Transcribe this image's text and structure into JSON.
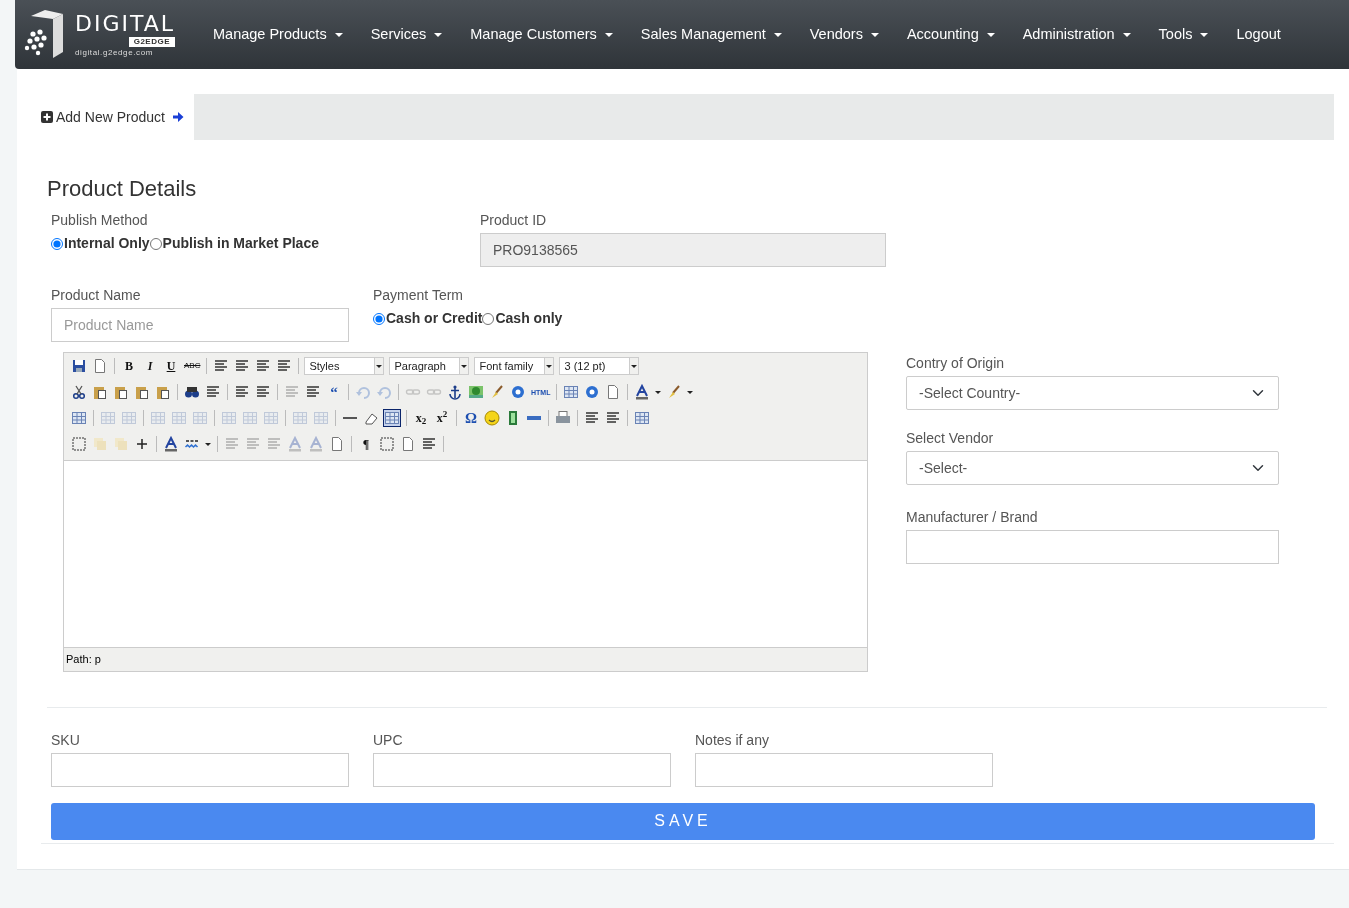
{
  "logo": {
    "word": "DIGITAL",
    "badge": "G2EDGE",
    "site": "digital.g2edge.com"
  },
  "menu": [
    {
      "label": "Manage Products",
      "dropdown": true
    },
    {
      "label": "Services",
      "dropdown": true
    },
    {
      "label": "Manage Customers",
      "dropdown": true
    },
    {
      "label": "Sales Management",
      "dropdown": true
    },
    {
      "label": "Vendors",
      "dropdown": true
    },
    {
      "label": "Accounting",
      "dropdown": true
    },
    {
      "label": "Administration",
      "dropdown": true
    },
    {
      "label": "Tools",
      "dropdown": true
    },
    {
      "label": "Logout",
      "dropdown": false
    }
  ],
  "breadcrumb": {
    "label": "Add New Product"
  },
  "heading": "Product Details",
  "publish_method": {
    "label": "Publish Method",
    "options": [
      {
        "label": "Internal Only",
        "selected": true
      },
      {
        "label": "Publish in Market Place",
        "selected": false
      }
    ]
  },
  "product_id": {
    "label": "Product ID",
    "value": "PRO9138565",
    "disabled": true
  },
  "product_name": {
    "label": "Product Name",
    "placeholder": "Product Name"
  },
  "payment_term": {
    "label": "Payment Term",
    "options": [
      {
        "label": "Cash or Credit",
        "selected": true
      },
      {
        "label": "Cash only",
        "selected": false
      }
    ]
  },
  "editor": {
    "toolbar": [
      [
        {
          "kind": "icon",
          "disabled": false,
          "active": false
        },
        {
          "kind": "icon",
          "disabled": false,
          "active": false
        },
        {
          "kind": "sep"
        },
        {
          "kind": "bold",
          "text": "B",
          "disabled": false,
          "active": false
        },
        {
          "kind": "italic",
          "text": "I",
          "disabled": false,
          "active": false
        },
        {
          "kind": "underline",
          "text": "U",
          "disabled": false,
          "active": false
        },
        {
          "kind": "strike",
          "text": "ABC",
          "disabled": false,
          "active": false
        },
        {
          "kind": "sep"
        },
        {
          "kind": "icon",
          "disabled": false,
          "active": false
        },
        {
          "kind": "icon",
          "disabled": false,
          "active": false
        },
        {
          "kind": "icon",
          "disabled": false,
          "active": false
        },
        {
          "kind": "icon",
          "disabled": false,
          "active": false
        },
        {
          "kind": "sep"
        },
        {
          "kind": "select",
          "text": "Styles"
        },
        {
          "kind": "select",
          "text": "Paragraph"
        },
        {
          "kind": "select",
          "text": "Font family"
        },
        {
          "kind": "select",
          "text": "3 (12 pt)"
        }
      ],
      [
        {
          "kind": "icon",
          "disabled": false,
          "active": false
        },
        {
          "kind": "icon",
          "disabled": false,
          "active": false
        },
        {
          "kind": "icon",
          "disabled": false,
          "active": false
        },
        {
          "kind": "icon",
          "disabled": false,
          "active": false
        },
        {
          "kind": "icon",
          "disabled": false,
          "active": false
        },
        {
          "kind": "sep"
        },
        {
          "kind": "icon",
          "disabled": false,
          "active": false
        },
        {
          "kind": "icon",
          "disabled": false,
          "active": false
        },
        {
          "kind": "sep"
        },
        {
          "kind": "icon",
          "disabled": false,
          "active": false
        },
        {
          "kind": "icon",
          "disabled": false,
          "active": false
        },
        {
          "kind": "sep"
        },
        {
          "kind": "icon",
          "disabled": true,
          "active": false
        },
        {
          "kind": "icon",
          "disabled": false,
          "active": false
        },
        {
          "kind": "glyph",
          "text": "“",
          "disabled": false,
          "active": false
        },
        {
          "kind": "sep"
        },
        {
          "kind": "icon",
          "disabled": true,
          "active": false
        },
        {
          "kind": "icon",
          "disabled": true,
          "active": false
        },
        {
          "kind": "sep"
        },
        {
          "kind": "icon",
          "disabled": true,
          "active": false
        },
        {
          "kind": "icon",
          "disabled": true,
          "active": false
        },
        {
          "kind": "icon",
          "disabled": false,
          "active": false
        },
        {
          "kind": "icon",
          "disabled": false,
          "active": false
        },
        {
          "kind": "icon",
          "disabled": false,
          "active": false
        },
        {
          "kind": "icon",
          "disabled": false,
          "active": false
        },
        {
          "kind": "tiny",
          "text": "HTML",
          "disabled": false,
          "active": false
        },
        {
          "kind": "sep"
        },
        {
          "kind": "icon",
          "disabled": false,
          "active": false
        },
        {
          "kind": "icon",
          "disabled": false,
          "active": false
        },
        {
          "kind": "icon",
          "disabled": false,
          "active": false
        },
        {
          "kind": "sep"
        },
        {
          "kind": "menu-icon",
          "disabled": false,
          "active": false
        },
        {
          "kind": "menu-icon",
          "disabled": false,
          "active": false
        }
      ],
      [
        {
          "kind": "icon",
          "disabled": false,
          "active": false
        },
        {
          "kind": "sep"
        },
        {
          "kind": "icon",
          "disabled": true,
          "active": false
        },
        {
          "kind": "icon",
          "disabled": true,
          "active": false
        },
        {
          "kind": "sep"
        },
        {
          "kind": "icon",
          "disabled": true,
          "active": false
        },
        {
          "kind": "icon",
          "disabled": true,
          "active": false
        },
        {
          "kind": "icon",
          "disabled": true,
          "active": false
        },
        {
          "kind": "sep"
        },
        {
          "kind": "icon",
          "disabled": true,
          "active": false
        },
        {
          "kind": "icon",
          "disabled": true,
          "active": false
        },
        {
          "kind": "icon",
          "disabled": true,
          "active": false
        },
        {
          "kind": "sep"
        },
        {
          "kind": "icon",
          "disabled": true,
          "active": false
        },
        {
          "kind": "icon",
          "disabled": true,
          "active": false
        },
        {
          "kind": "sep"
        },
        {
          "kind": "icon",
          "disabled": false,
          "active": false
        },
        {
          "kind": "icon",
          "disabled": false,
          "active": false
        },
        {
          "kind": "icon",
          "disabled": false,
          "active": true
        },
        {
          "kind": "sep"
        },
        {
          "kind": "bold",
          "text": "x$_{2}$",
          "disabled": false,
          "active": false
        },
        {
          "kind": "bold",
          "text": "x$^{2}$",
          "disabled": false,
          "active": false
        },
        {
          "kind": "sep"
        },
        {
          "kind": "glyph",
          "text": "Ω",
          "disabled": false,
          "active": false
        },
        {
          "kind": "icon",
          "disabled": false,
          "active": false
        },
        {
          "kind": "icon",
          "disabled": false,
          "active": false
        },
        {
          "kind": "icon",
          "disabled": false,
          "active": false
        },
        {
          "kind": "sep"
        },
        {
          "kind": "icon",
          "disabled": false,
          "active": false
        },
        {
          "kind": "sep"
        },
        {
          "kind": "icon",
          "disabled": false,
          "active": false
        },
        {
          "kind": "icon",
          "disabled": false,
          "active": false
        },
        {
          "kind": "sep"
        },
        {
          "kind": "icon",
          "disabled": false,
          "active": false
        }
      ],
      [
        {
          "kind": "icon",
          "disabled": false,
          "active": false
        },
        {
          "kind": "icon",
          "disabled": true,
          "active": false
        },
        {
          "kind": "icon",
          "disabled": true,
          "active": false
        },
        {
          "kind": "icon",
          "disabled": false,
          "active": false
        },
        {
          "kind": "sep"
        },
        {
          "kind": "icon",
          "disabled": false,
          "active": false
        },
        {
          "kind": "menu-icon",
          "disabled": false,
          "active": false
        },
        {
          "kind": "sep"
        },
        {
          "kind": "icon",
          "disabled": true,
          "active": false
        },
        {
          "kind": "icon",
          "disabled": true,
          "active": false
        },
        {
          "kind": "icon",
          "disabled": true,
          "active": false
        },
        {
          "kind": "icon",
          "disabled": true,
          "active": false
        },
        {
          "kind": "icon",
          "disabled": true,
          "active": false
        },
        {
          "kind": "icon",
          "disabled": false,
          "active": false
        },
        {
          "kind": "sep"
        },
        {
          "kind": "bold",
          "text": "¶",
          "disabled": false,
          "active": false
        },
        {
          "kind": "icon",
          "disabled": false,
          "active": false
        },
        {
          "kind": "icon",
          "disabled": false,
          "active": false
        },
        {
          "kind": "icon",
          "disabled": false,
          "active": false
        },
        {
          "kind": "sep"
        }
      ]
    ],
    "path": "Path: p"
  },
  "country": {
    "label": "Contry of Origin",
    "value": "-Select Country-"
  },
  "vendor": {
    "label": "Select Vendor",
    "value": "-Select-"
  },
  "manufacturer": {
    "label": "Manufacturer / Brand"
  },
  "bottom_fields": [
    {
      "label": "SKU"
    },
    {
      "label": "UPC"
    },
    {
      "label": "Notes if any"
    }
  ],
  "save_button": "SAVE"
}
